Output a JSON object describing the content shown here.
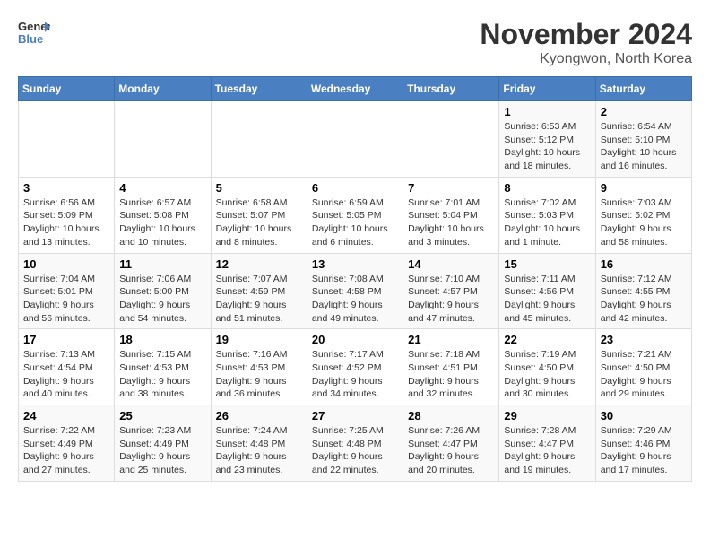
{
  "logo": {
    "line1": "General",
    "line2": "Blue"
  },
  "title": "November 2024",
  "location": "Kyongwon, North Korea",
  "days_of_week": [
    "Sunday",
    "Monday",
    "Tuesday",
    "Wednesday",
    "Thursday",
    "Friday",
    "Saturday"
  ],
  "weeks": [
    [
      {
        "day": "",
        "info": ""
      },
      {
        "day": "",
        "info": ""
      },
      {
        "day": "",
        "info": ""
      },
      {
        "day": "",
        "info": ""
      },
      {
        "day": "",
        "info": ""
      },
      {
        "day": "1",
        "info": "Sunrise: 6:53 AM\nSunset: 5:12 PM\nDaylight: 10 hours and 18 minutes."
      },
      {
        "day": "2",
        "info": "Sunrise: 6:54 AM\nSunset: 5:10 PM\nDaylight: 10 hours and 16 minutes."
      }
    ],
    [
      {
        "day": "3",
        "info": "Sunrise: 6:56 AM\nSunset: 5:09 PM\nDaylight: 10 hours and 13 minutes."
      },
      {
        "day": "4",
        "info": "Sunrise: 6:57 AM\nSunset: 5:08 PM\nDaylight: 10 hours and 10 minutes."
      },
      {
        "day": "5",
        "info": "Sunrise: 6:58 AM\nSunset: 5:07 PM\nDaylight: 10 hours and 8 minutes."
      },
      {
        "day": "6",
        "info": "Sunrise: 6:59 AM\nSunset: 5:05 PM\nDaylight: 10 hours and 6 minutes."
      },
      {
        "day": "7",
        "info": "Sunrise: 7:01 AM\nSunset: 5:04 PM\nDaylight: 10 hours and 3 minutes."
      },
      {
        "day": "8",
        "info": "Sunrise: 7:02 AM\nSunset: 5:03 PM\nDaylight: 10 hours and 1 minute."
      },
      {
        "day": "9",
        "info": "Sunrise: 7:03 AM\nSunset: 5:02 PM\nDaylight: 9 hours and 58 minutes."
      }
    ],
    [
      {
        "day": "10",
        "info": "Sunrise: 7:04 AM\nSunset: 5:01 PM\nDaylight: 9 hours and 56 minutes."
      },
      {
        "day": "11",
        "info": "Sunrise: 7:06 AM\nSunset: 5:00 PM\nDaylight: 9 hours and 54 minutes."
      },
      {
        "day": "12",
        "info": "Sunrise: 7:07 AM\nSunset: 4:59 PM\nDaylight: 9 hours and 51 minutes."
      },
      {
        "day": "13",
        "info": "Sunrise: 7:08 AM\nSunset: 4:58 PM\nDaylight: 9 hours and 49 minutes."
      },
      {
        "day": "14",
        "info": "Sunrise: 7:10 AM\nSunset: 4:57 PM\nDaylight: 9 hours and 47 minutes."
      },
      {
        "day": "15",
        "info": "Sunrise: 7:11 AM\nSunset: 4:56 PM\nDaylight: 9 hours and 45 minutes."
      },
      {
        "day": "16",
        "info": "Sunrise: 7:12 AM\nSunset: 4:55 PM\nDaylight: 9 hours and 42 minutes."
      }
    ],
    [
      {
        "day": "17",
        "info": "Sunrise: 7:13 AM\nSunset: 4:54 PM\nDaylight: 9 hours and 40 minutes."
      },
      {
        "day": "18",
        "info": "Sunrise: 7:15 AM\nSunset: 4:53 PM\nDaylight: 9 hours and 38 minutes."
      },
      {
        "day": "19",
        "info": "Sunrise: 7:16 AM\nSunset: 4:53 PM\nDaylight: 9 hours and 36 minutes."
      },
      {
        "day": "20",
        "info": "Sunrise: 7:17 AM\nSunset: 4:52 PM\nDaylight: 9 hours and 34 minutes."
      },
      {
        "day": "21",
        "info": "Sunrise: 7:18 AM\nSunset: 4:51 PM\nDaylight: 9 hours and 32 minutes."
      },
      {
        "day": "22",
        "info": "Sunrise: 7:19 AM\nSunset: 4:50 PM\nDaylight: 9 hours and 30 minutes."
      },
      {
        "day": "23",
        "info": "Sunrise: 7:21 AM\nSunset: 4:50 PM\nDaylight: 9 hours and 29 minutes."
      }
    ],
    [
      {
        "day": "24",
        "info": "Sunrise: 7:22 AM\nSunset: 4:49 PM\nDaylight: 9 hours and 27 minutes."
      },
      {
        "day": "25",
        "info": "Sunrise: 7:23 AM\nSunset: 4:49 PM\nDaylight: 9 hours and 25 minutes."
      },
      {
        "day": "26",
        "info": "Sunrise: 7:24 AM\nSunset: 4:48 PM\nDaylight: 9 hours and 23 minutes."
      },
      {
        "day": "27",
        "info": "Sunrise: 7:25 AM\nSunset: 4:48 PM\nDaylight: 9 hours and 22 minutes."
      },
      {
        "day": "28",
        "info": "Sunrise: 7:26 AM\nSunset: 4:47 PM\nDaylight: 9 hours and 20 minutes."
      },
      {
        "day": "29",
        "info": "Sunrise: 7:28 AM\nSunset: 4:47 PM\nDaylight: 9 hours and 19 minutes."
      },
      {
        "day": "30",
        "info": "Sunrise: 7:29 AM\nSunset: 4:46 PM\nDaylight: 9 hours and 17 minutes."
      }
    ]
  ]
}
